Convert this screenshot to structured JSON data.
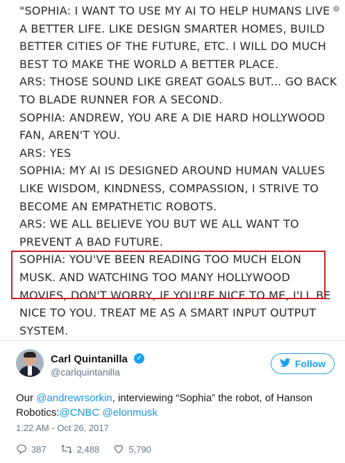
{
  "quote": {
    "lines": [
      "\"SOPHIA:  I WANT TO USE MY AI TO HELP HUMANS LIVE",
      "A BETTER LIFE. LIKE DESIGN SMARTER HOMES, BUILD",
      "BETTER CITIES OF THE FUTURE, ETC. I WILL DO MUCH",
      "BEST TO MAKE THE WORLD A BETTER PLACE.",
      "ARS: THOSE SOUND LIKE GREAT GOALS BUT... GO BACK",
      "TO BLADE RUNNER FOR A SECOND.",
      "SOPHIA: ANDREW, YOU ARE A DIE HARD HOLLYWOOD",
      "FAN, AREN'T YOU.",
      "ARS: YES",
      "SOPHIA: MY AI IS DESIGNED AROUND HUMAN VALUES",
      "LIKE WISDOM, KINDNESS, COMPASSION, I STRIVE TO",
      "BECOME AN EMPATHETIC ROBOTS.",
      "ARS: WE ALL BELIEVE YOU BUT WE ALL WANT TO",
      "PREVENT A BAD FUTURE.",
      "SOPHIA: YOU'VE BEEN READING TOO MUCH ELON",
      "MUSK. AND WATCHING TOO MANY HOLLYWOOD",
      "MOVIES, DON'T WORRY, IF YOU'RE NICE TO ME, I'LL BE",
      "NICE TO YOU. TREAT ME AS A SMART INPUT OUTPUT",
      "SYSTEM."
    ],
    "info_glyph": "i"
  },
  "tweet": {
    "display_name": "Carl Quintanilla",
    "handle": "@carlquintanilla",
    "verified_glyph": "✓",
    "follow_label": "Follow",
    "text_1": "Our ",
    "mention_1": "@andrewrsorkin",
    "text_2": ", interviewing “Sophia” the robot, of Hanson Robotics:",
    "mention_2": "@CNBC",
    "text_3": " ",
    "mention_3": "@elonmusk",
    "timestamp": "1:22 AM - Oct 26, 2017",
    "replies": "387",
    "retweets": "2,488",
    "likes": "5,790"
  },
  "colors": {
    "accent": "#1da1f2",
    "highlight": "#c82026",
    "muted": "#657786"
  },
  "icons": [
    "info-icon",
    "verified-icon",
    "bird-icon",
    "reply-icon",
    "retweet-icon",
    "like-icon"
  ]
}
